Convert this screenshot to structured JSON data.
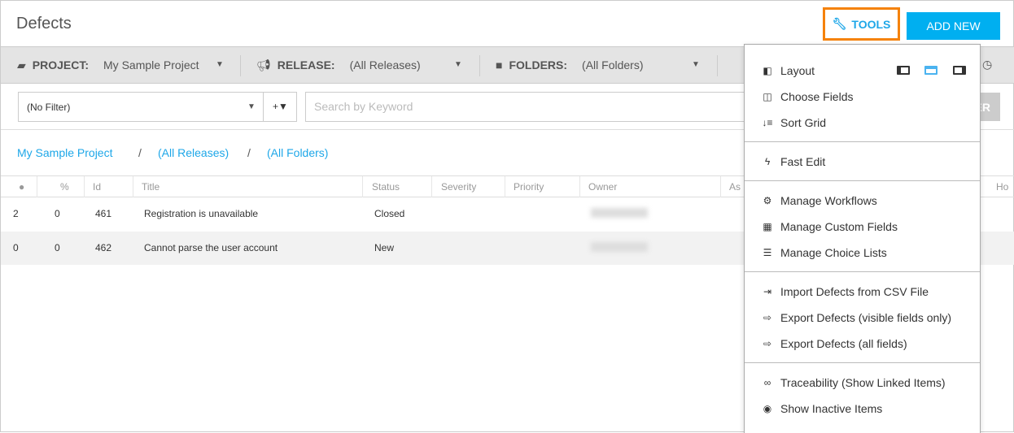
{
  "header": {
    "title": "Defects",
    "tools_label": "TOOLS",
    "add_new_label": "ADD NEW"
  },
  "selectors": {
    "project_label": "PROJECT:",
    "project_value": "My Sample Project",
    "release_label": "RELEASE:",
    "release_value": "(All Releases)",
    "folders_label": "FOLDERS:",
    "folders_value": "(All Folders)"
  },
  "filter": {
    "value": "(No Filter)",
    "search_placeholder": "Search by Keyword",
    "filter_button": "FILTER"
  },
  "breadcrumb": [
    "My Sample Project",
    "(All Releases)",
    "(All Folders)"
  ],
  "breadcrumb_sep": "/",
  "columns": [
    "Id",
    "Title",
    "Status",
    "Severity",
    "Priority",
    "Owner",
    "As",
    "Ho"
  ],
  "rows": [
    {
      "comments": "2",
      "links": "0",
      "id": "461",
      "title": "Registration is unavailable",
      "status": "Closed"
    },
    {
      "comments": "0",
      "links": "0",
      "id": "462",
      "title": "Cannot parse the user account",
      "status": "New"
    }
  ],
  "menu": {
    "layout": "Layout",
    "choose_fields": "Choose Fields",
    "sort_grid": "Sort Grid",
    "fast_edit": "Fast Edit",
    "manage_workflows": "Manage Workflows",
    "manage_custom_fields": "Manage Custom Fields",
    "manage_choice_lists": "Manage Choice Lists",
    "import_csv": "Import Defects from CSV File",
    "export_visible": "Export Defects (visible fields only)",
    "export_all": "Export Defects (all fields)",
    "traceability": "Traceability (Show Linked Items)",
    "show_inactive": "Show Inactive Items"
  },
  "colors": {
    "accent": "#1ea7e8",
    "highlight": "#f5820b",
    "primary_button": "#00aff0"
  }
}
